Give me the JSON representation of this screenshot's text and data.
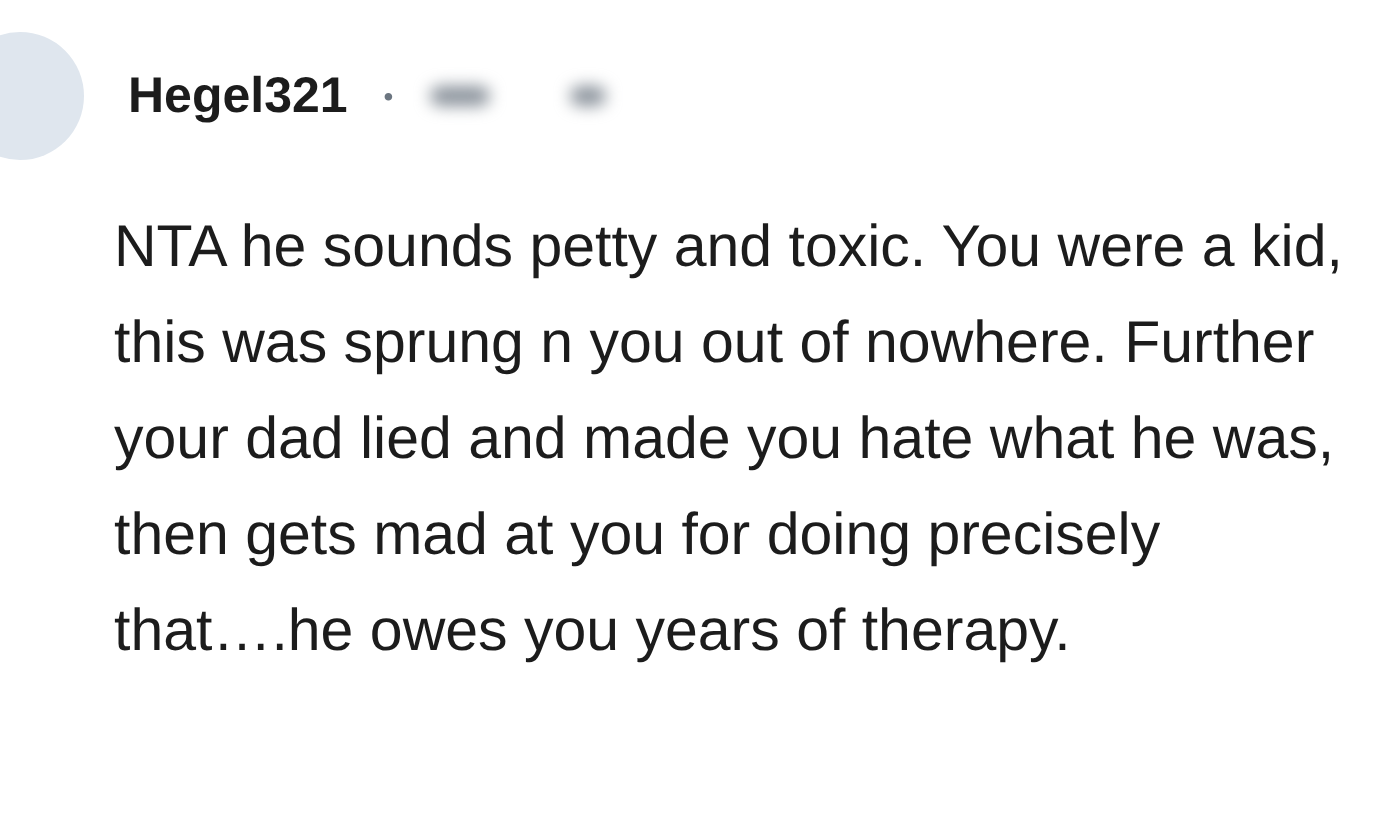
{
  "comment": {
    "author": "Hegel321",
    "separator": "•",
    "body": "NTA he sounds petty and toxic. You were a kid, this was sprung n you out of nowhere. Further your dad lied and made you hate what he was, then gets mad at you for doing precisely that….he owes you years of therapy."
  }
}
